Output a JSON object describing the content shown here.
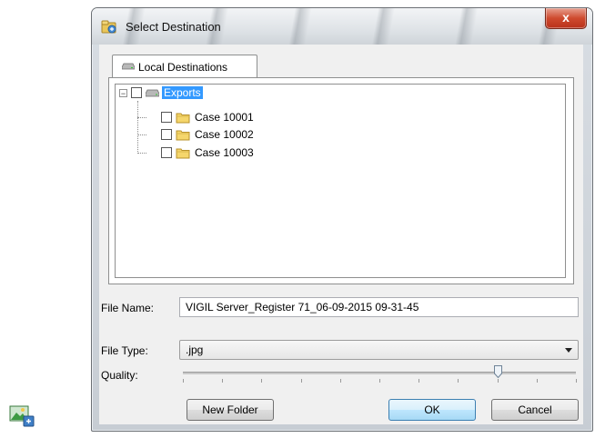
{
  "window": {
    "title": "Select Destination",
    "close_label": "x"
  },
  "tabs": [
    {
      "label": "Local Destinations",
      "icon": "drive-icon"
    }
  ],
  "tree": {
    "root": {
      "label": "Exports",
      "expander": "−",
      "checked": false,
      "selected": true,
      "icon": "drive-icon"
    },
    "children": [
      {
        "label": "Case 10001",
        "checked": false,
        "icon": "folder-icon"
      },
      {
        "label": "Case 10002",
        "checked": false,
        "icon": "folder-icon"
      },
      {
        "label": "Case 10003",
        "checked": false,
        "icon": "folder-icon"
      }
    ]
  },
  "form": {
    "file_name_label": "File Name:",
    "file_name_value": "VIGIL Server_Register 71_06-09-2015 09-31-45",
    "file_type_label": "File Type:",
    "file_type_value": ".jpg",
    "quality_label": "Quality:",
    "quality_level_fraction": 0.8
  },
  "buttons": {
    "new_folder": "New Folder",
    "ok": "OK",
    "cancel": "Cancel"
  },
  "colors": {
    "selection": "#3399ff",
    "close_button": "#c9432a",
    "default_button_border": "#3c7fb1"
  }
}
